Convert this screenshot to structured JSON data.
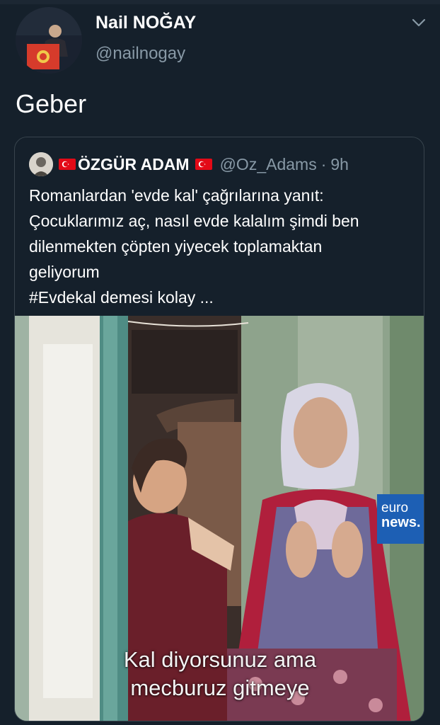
{
  "tweet": {
    "author_name": "Nail NOĞAY",
    "author_handle": "@nailnogay",
    "text": "Geber"
  },
  "quoted_tweet": {
    "author_name": "ÖZGÜR ADAM",
    "author_handle": "@Oz_Adams",
    "separator": "·",
    "time": "9h",
    "text_lines": [
      "Romanlardan 'evde kal' çağrılarına yanıt:",
      "Çocuklarımız aç, nasıl evde kalalım şimdi ben",
      "dilenmekten çöpten yiyecek toplamaktan",
      "geliyorum",
      "#Evdekal demesi kolay ..."
    ],
    "video": {
      "logo_line1": "euro",
      "logo_line2": "news.",
      "subtitle_line1": "Kal diyorsunuz ama",
      "subtitle_line2": "mecburuz gitmeye"
    }
  },
  "icons": {
    "more": "chevron-down-icon",
    "flag": "turkey-flag-icon"
  },
  "colors": {
    "background": "#15202b",
    "secondary_text": "#8899a6",
    "border": "#38444d",
    "flag_red": "#e30a17",
    "logo_blue": "#1d5fb4"
  }
}
